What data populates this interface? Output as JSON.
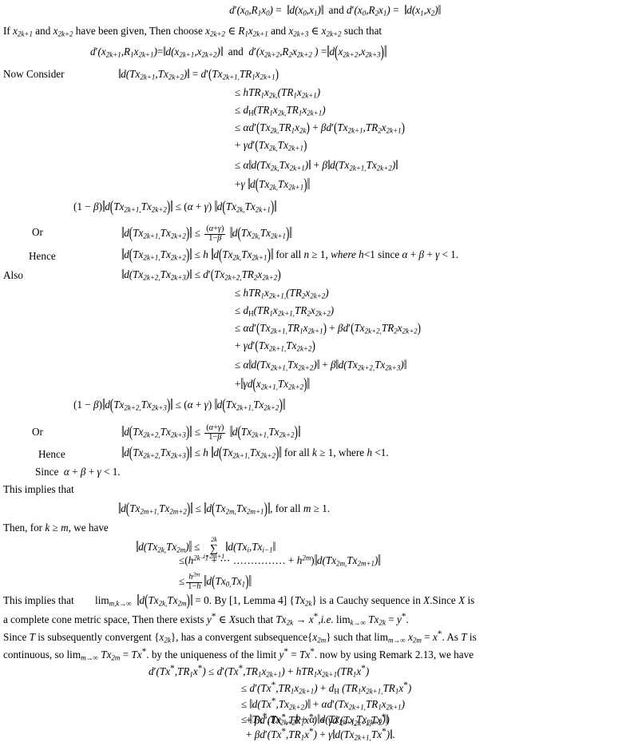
{
  "document": {
    "type": "mathematical-proof-page",
    "language": "en",
    "font_color": "#000000",
    "background_color": "#ffffff"
  },
  "labels": {
    "now_consider": "Now Consider",
    "or_1": "Or",
    "hence_1": "Hence",
    "also": "Also",
    "or_2": "Or",
    "hence_2": "Hence",
    "since": "Since",
    "this_implies_that_1": "This implies that",
    "then_for_k": "Then, for k ≥ m, we have",
    "this_implies_that_2": "This implies that",
    "if_prefix": "If",
    "and_word": "and",
    "such_that": "such that",
    "have_been_given": "have been given, Then choose",
    "for_all_n": "for all n ≥ 1, where h<1 since α + β + γ < 1.",
    "for_all_k": "for all k ≥ 1, where h <1.",
    "for_all_m": ", for all m ≥ 1."
  },
  "lines": {
    "l01": "d′(x₀,R₁x₀) = ‖d(x₀,x₁)‖ and d′(x₀,R₂x₁) = ‖d(x₁,x₂)‖",
    "l02": "If x₂ₖ₊₁ and x₂ₖ₊₂ have been given, Then choose x₂ₖ₊₂ ∈ R₁x₂ₖ₊₁ and x₂ₖ₊₃ ∈ x₂ₖ₊₂ such that",
    "l03": "d′(x₂ₖ₊₁,R₁x₂ₖ₊₁)=‖d(x₂ₖ₊₁,x₂ₖ₊₂)‖ and d′(x₂ₖ₊₂,R₂x₂ₖ₊₂ ) =‖d(x₂ₖ₊₂,x₂ₖ₊₃)‖",
    "l04": "‖d(Tx₂ₖ₊₁,Tx₂ₖ₊₂)‖ = d′(Tx₂ₖ₊₁,TR₁x₂ₖ₊₁)",
    "l05": "≤ hTR₁x₂ₖ,(TR₁x₂ₖ₊₁)",
    "l06": "≤ d_H(TR₁x₂ₖ,TR₁x₂ₖ₊₁)",
    "l07": "≤ αd′(Tx₂ₖ,TR₁x₂ₖ) + βd′(Tx₂ₖ₊₁,TR₂x₂ₖ₊₁)",
    "l08": "+ γd′(Tx₂ₖ,Tx₂ₖ₊₁)",
    "l09": "≤ α‖d(Tx₂ₖ,Tx₂ₖ₊₁)‖ + β‖d(Tx₂ₖ₊₁,Tx₂ₖ₊₂)‖",
    "l10": "+γ ‖d(Tx₂ₖ,Tx₂ₖ₊₁)‖",
    "l11": "(1 − β)‖d(Tx₂ₖ₊₁,Tx₂ₖ₊₂)‖ ≤ (α + γ) ‖d(Tx₂ₖ,Tx₂ₖ₊₁)‖",
    "l12": "‖d(Tx₂ₖ₊₁,Tx₂ₖ₊₂)‖ ≤ (α+γ)/(1−β) ‖d(Tx₂ₖ,Tx₂ₖ₊₁)‖",
    "l13": "‖d(Tx₂ₖ₊₁,Tx₂ₖ₊₂)‖ ≤ h ‖d(Tx₂ₖ,Tx₂ₖ₊₁)‖ for all n ≥ 1, where h<1 since α + β + γ < 1.",
    "l14": "‖d(Tx₂ₖ₊₂,Tx₂ₖ₊₃)‖ ≤ d′(Tx₂ₖ₊₂,TR₂x₂ₖ₊₂)",
    "l15": "≤ hTR₁x₂ₖ₊₁,(TR₂x₂ₖ₊₂)",
    "l16": "≤ d_H(TR₁x₂ₖ₊₁,TR₂x₂ₖ₊₂)",
    "l17": "≤ αd′(Tx₂ₖ₊₁,TR₁x₂ₖ₊₁) + βd′(Tx₂ₖ₊₂,TR₂x₂ₖ₊₂)",
    "l18": "+ γd′(Tx₂ₖ₊₁,Tx₂ₖ₊₂)",
    "l19": "≤ α‖d(Tx₂ₖ₊₁,Tx₂ₖ₊₂)‖ + β‖d(Tx₂ₖ₊₂,Tx₂ₖ₊₃)‖",
    "l20": "+‖γd(x₂ₖ₊₁,Tx₂ₖ₊₂)‖",
    "l21": "(1 − β)‖d(Tx₂ₖ₊₂,Tx₂ₖ₊₃)‖ ≤ (α + γ) ‖d(Tx₂ₖ₊₁,Tx₂ₖ₊₂)‖",
    "l22": "‖d(Tx₂ₖ₊₂,Tx₂ₖ₊₃)‖ ≤ (α+γ)/(1−β) ‖d(Tx₂ₖ₊₁,Tx₂ₖ₊₂)‖",
    "l23": "‖d(Tx₂ₖ₊₂,Tx₂ₖ₊₃)‖ ≤ h ‖d(Tx₂ₖ₊₁,Tx₂ₖ₊₂)‖ for all k ≥ 1, where h <1.",
    "l24": "Since α + β + γ < 1.",
    "l25": "This implies that",
    "l26": "‖d(Tx₂ₘ₊₁,Tx₂ₘ₊₂)‖ ≤ ‖d(Tx₂ₘ,Tx₂ₘ₊₁)‖, for all m ≥ 1.",
    "l27": "Then, for k ≥ m, we have",
    "l28": "‖d(Tx₂ₖ,Tx₂ₘ)‖ ≤ ∑_{i=2m+1}^{2k}‖d(Txᵢ,Txᵢ₋₁‖",
    "l29": "≤(h^{2k−1} + ⋯ …………… + h^{2m})‖d(Tx₂ₘ,Tx₂ₘ₊₁)‖",
    "l30": "≤ h^{2m}/(1−h) ‖d(Tx₀,Tx₁)‖",
    "l31": "This implies that lim_{m,k→∞} ‖d(Tx₂ₖ,Tx₂ₘ)‖ = 0. By [1, Lemma 4] {Tx₂ₖ} is a Cauchy sequence in X.Since X is",
    "l32": "a complete cone metric space, Then there exists y* ∈ Xsuch that Tx₂ₖ → x*,i.e. lim_{k→∞} Tx₂ₖ = y*.",
    "l33": "Since T is subsequently convergent {x₂ₖ}, has a convergent subsequence{x₂ₘ} such that lim_{m→∞} x₂ₘ = x*. As T is",
    "l34": "continuous, so lim_{m→∞} Tx₂ₘ = Tx*. by the uniqueness of the limit y* = Tx*. now by using Remark 2.13, we have",
    "l35": "d′(Tx*,TR₁x*) ≤ d′(Tx*,TR₁x₂ₖ₊₁) + hTR₁x₂ₖ₊₁(TR₁x*)",
    "l36": "≤ d′(Tx*,TR₁x₂ₖ₊₁) + d_H (TR₁x₂ₖ₊₁,TR₁x*)",
    "l37": "≤ ‖d(Tx*,Tx₂ₖ₊₂)‖ + αd′(Tx₂ₖ₊₁,TR₁x₂ₖ₊₁)",
    "l38": "+ βd′(Tx*,TR₁x*) + γd′(Tx₂ₖ₊₁,Tx*)",
    "l39": "≤ ‖Tx*,Tx₂ₖ₊₂‖ + α ‖d(Tx₂ₖ₊₁,Tx₂ₖ₊₂)‖",
    "l40": "+ βd′(Tx*,TR₁x*) + γ‖d(Tx₂ₖ₊₁,Tx*)‖."
  },
  "symbols": {
    "alpha": "α",
    "beta": "β",
    "gamma": "γ",
    "leq": "≤",
    "geq": "≥",
    "in": "∈",
    "to": "→",
    "infty": "∞",
    "sigma": "∑",
    "prime": "′",
    "dbar": "‖"
  },
  "references": {
    "citation": "[1, Lemma 4]",
    "remark": "Remark 2.13"
  }
}
